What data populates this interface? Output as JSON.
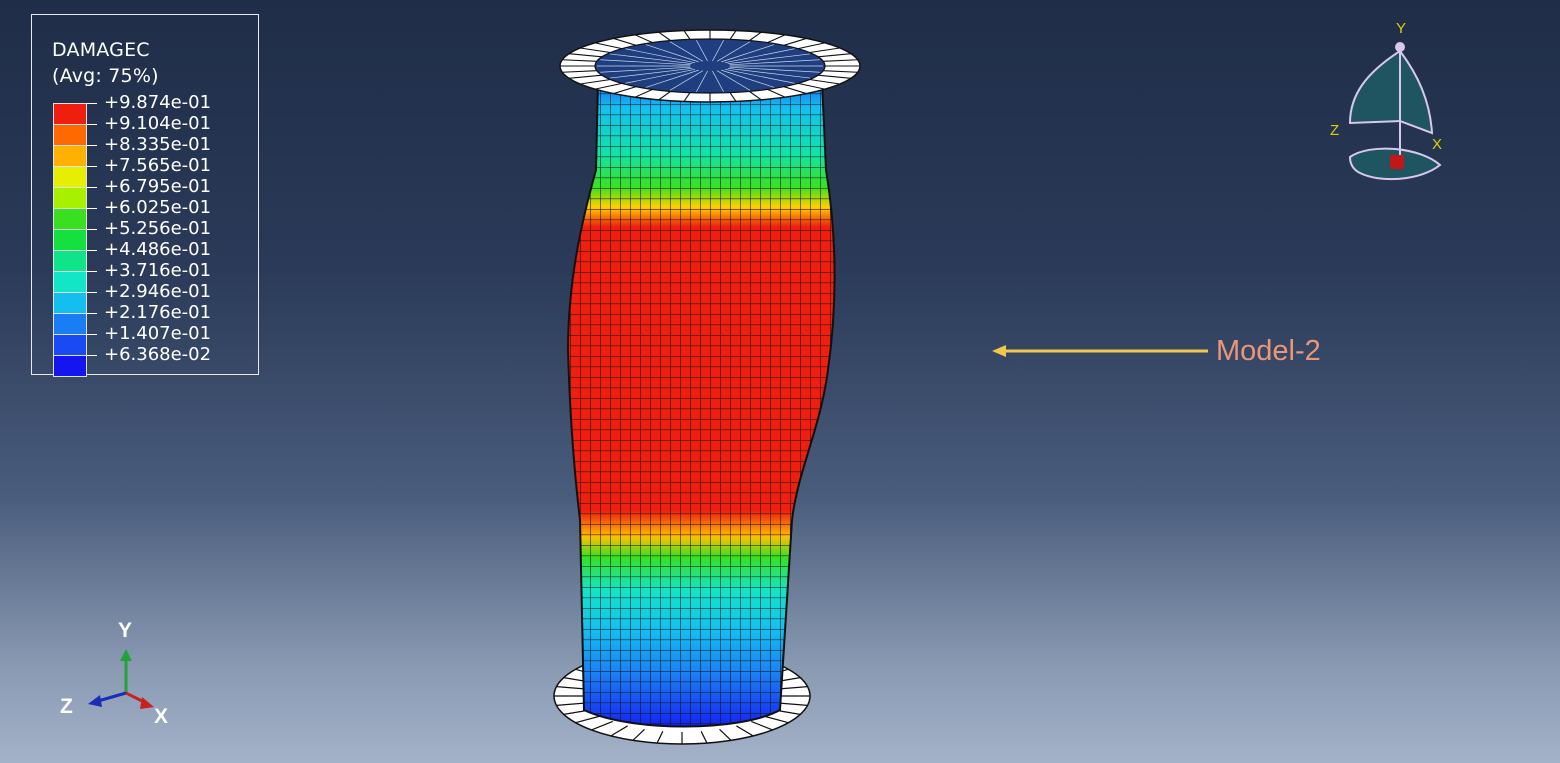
{
  "legend": {
    "title": "DAMAGEC",
    "subtitle": "(Avg: 75%)",
    "values": [
      "+9.874e-01",
      "+9.104e-01",
      "+8.335e-01",
      "+7.565e-01",
      "+6.795e-01",
      "+6.025e-01",
      "+5.256e-01",
      "+4.486e-01",
      "+3.716e-01",
      "+2.946e-01",
      "+2.176e-01",
      "+1.407e-01",
      "+6.368e-02"
    ],
    "colors": [
      "#ee1f0f",
      "#ff6a00",
      "#ffb000",
      "#e6ef00",
      "#a8ef00",
      "#3ae020",
      "#14e040",
      "#10e488",
      "#12e6c6",
      "#14bff0",
      "#1a7df4",
      "#1a4af4",
      "#1515f0"
    ]
  },
  "annotation": {
    "label": "Model-2",
    "arrow_color": "#f2c64a",
    "label_color": "#e99778"
  },
  "triad_bottom": {
    "x": "X",
    "y": "Y",
    "z": "Z"
  },
  "triad_top": {
    "x": "X",
    "y": "Y",
    "z": "Z"
  }
}
